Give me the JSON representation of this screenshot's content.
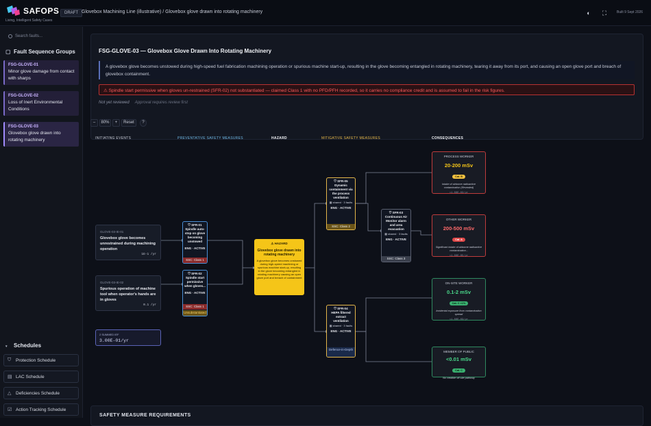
{
  "app": {
    "brand": "SAFOPS",
    "tagline": "Living, Intelligent Safety Cases",
    "badge": "DRAFT",
    "breadcrumb": "Glovebox Machining Line (illustrative) / Glovebox glove drawn into rotating machinery",
    "built": "Built 9 Sept 2026"
  },
  "sidebar": {
    "search_placeholder": "Search faults...",
    "fsg_heading": "Fault Sequence Groups",
    "fsg_items": [
      {
        "id": "FSG-GLOVE-01",
        "title": "Minor glove damage from contact with sharps"
      },
      {
        "id": "FSG-GLOVE-02",
        "title": "Loss of Inert Environmental Conditions"
      },
      {
        "id": "FSG-GLOVE-03",
        "title": "Glovebox glove drawn into rotating machinery"
      }
    ],
    "schedules_heading": "Schedules",
    "schedules": [
      {
        "label": "Protection Schedule",
        "icon": "shield-icon"
      },
      {
        "label": "LAC Schedule",
        "icon": "document-icon"
      },
      {
        "label": "Deficiencies Schedule",
        "icon": "warning-icon"
      },
      {
        "label": "Action Tracking Schedule",
        "icon": "checklist-icon"
      }
    ]
  },
  "main": {
    "title": "FSG-GLOVE-03 — Glovebox Glove Drawn Into Rotating Machinery",
    "description": "A glovebox glove becomes unstowed during high-speed fuel fabrication machining operation or spurious machine start-up, resulting in the glove becoming entangled in rotating machinery, tearing it away from its port, and causing an open glove port and breach of glovebox containment.",
    "warning": "Spindle start permissive when gloves un-restrained (SFR-02) not substantiated — claimed Class 1 with no PFD/PFH recorded, so it carries no compliance credit and is assumed to fail in the risk figures.",
    "review_status": "Not yet reviewed",
    "review_note": "Approval requires review first",
    "zoom": {
      "minus": "–",
      "level": "80%",
      "plus": "+",
      "reset": "Reset",
      "help": "?"
    },
    "requirements_heading": "SAFETY MEASURE REQUIREMENTS"
  },
  "diagram": {
    "columns": {
      "initiating": "INITIATING EVENTS",
      "preventative": "PREVENTATIVE SAFETY MEASURES",
      "hazard": "HAZARD",
      "mitigative": "MITIGATIVE SAFETY MEASURES",
      "consequences": "CONSEQUENCES"
    },
    "initiating_events": [
      {
        "id": "GLOVE-03-IE-01",
        "text": "Glovebox glove becomes unrestrained during machining operation",
        "freq": "1E-1 /yr"
      },
      {
        "id": "GLOVE-03-IE-02",
        "text": "Spurious operation of machine tool when operator's hands are in gloves",
        "freq": "0.1 /yr"
      }
    ],
    "summed": {
      "label": "2 SUMMED IEF",
      "value": "3.00E-01/yr"
    },
    "preventative": [
      {
        "id": "SFR-01",
        "name": "Spindle auto-stop on glove becoming unstowed",
        "eng": "ENG · ACTIVE",
        "ssc": "SSC: Class 1"
      },
      {
        "id": "SFR-02",
        "name": "Spindle start permissive when gloves...",
        "eng": "ENG · ACTIVE",
        "ssc": "SSC: Class 1",
        "flag": "Unsubstantiated"
      }
    ],
    "hazard": {
      "label": "⚠ HAZARD",
      "name": "Glovebox glove drawn into rotating machinery",
      "text": "A glovebox glove becomes unstowed during high-speed machining or spurious machine start-up, resulting in the glove becoming entangled in rotating machinery causing an open glove port and breach of containment"
    },
    "mitigative": [
      {
        "id": "SFR-05",
        "name": "Dynamic containment via the process ventilation",
        "shared": "▦ shared · 3 faults",
        "eng": "ENG · ACTIVE",
        "ssc": "SSC: Class 2"
      },
      {
        "id": "SFR-03",
        "name": "Continuous Air Monitor alarm and area evacuation",
        "shared": "▦ shared · 3 faults",
        "eng": "ENG · ACTIVE",
        "ssc": "SSC: Class 3"
      },
      {
        "id": "SFR-04",
        "name": "HEPA filtered extract ventilation",
        "shared": "▦ shared · 3 faults",
        "eng": "ENG · ACTIVE",
        "ssc": "Defence-in-Depth"
      }
    ],
    "consequences": [
      {
        "title": "PROCESS WORKER",
        "dose": "20-200 mSv",
        "cat": "Cat. B",
        "desc": "Intake of airborne radioactive contamination (Revealed)",
        "freq": "<1.00E-03/yr",
        "color": "#c03c3c",
        "cat_color": "#f0c040"
      },
      {
        "title": "OTHER WORKER",
        "dose": "200-500 mSv",
        "cat": "Cat. A",
        "desc": "Significant intake of airborne radioactive contamination...",
        "freq": "<1.00E-05/yr",
        "color": "#c03c3c",
        "cat_color": "#e04848"
      },
      {
        "title": "ON-SITE WORKER",
        "dose": "0.1-2 mSv",
        "cat": "Cat. C <1%",
        "desc": "Incidental exposure from contamination spread",
        "freq": "<1.00E-03/yr",
        "color": "#2f8a60",
        "cat_color": "#3ab070"
      },
      {
        "title": "MEMBER OF PUBLIC",
        "dose": "<0.01 mSv",
        "cat": "Cat. C",
        "desc": "No credible off-site pathway",
        "freq": "",
        "color": "#2f8a60",
        "cat_color": "#3ab070"
      }
    ]
  }
}
